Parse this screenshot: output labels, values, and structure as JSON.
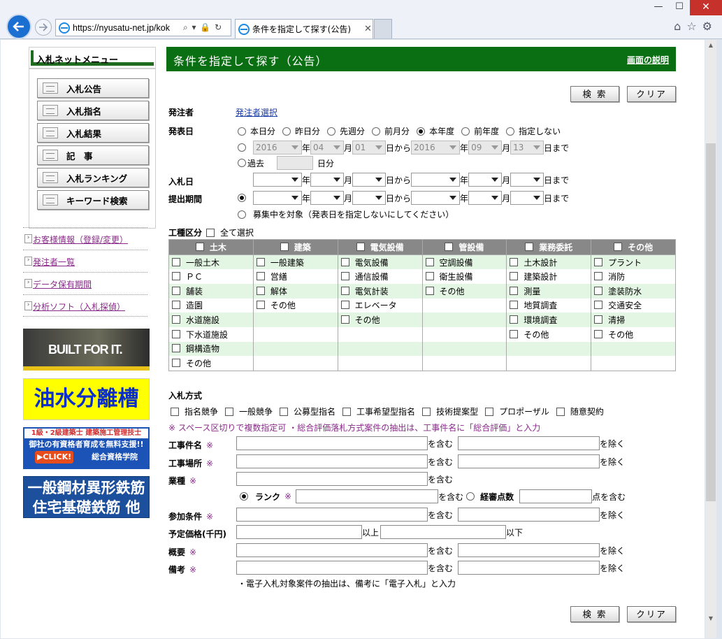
{
  "browser": {
    "url": "https://nyusatu-net.jp/kok",
    "tab_title": "条件を指定して探す(公告)",
    "window_controls": [
      "—",
      "☐",
      "✕"
    ]
  },
  "sidebar": {
    "menu_title": "入札ネットメニュー",
    "menu_items": [
      "入札公告",
      "入札指名",
      "入札結果",
      "記　事",
      "入札ランキング",
      "キーワード検索"
    ],
    "links": [
      "お客様情報（登録/変更）",
      "発注者一覧",
      "データ保有期間",
      "分析ソフト（入札探偵）"
    ],
    "banners": {
      "built": "BUILT FOR IT.",
      "oil": "油水分離槽",
      "school_line1": "1級・2級建築士 建築施工管理技士",
      "school_line2": "御社の有資格者育成を無料支援!!",
      "school_click": "▶CLICK!",
      "school_name": "総合資格学院",
      "steel_line1": "一般鋼材異形鉄筋",
      "steel_line2": "住宅基礎鉄筋 他"
    }
  },
  "main": {
    "title": "条件を指定して探す（公告）",
    "help_link": "画面の説明",
    "search_label": "検 索",
    "clear_label": "クリア",
    "orderer": {
      "label": "発注者",
      "link": "発注者選択"
    },
    "announce": {
      "label": "発表日",
      "options": [
        "本日分",
        "昨日分",
        "先週分",
        "前月分",
        "本年度",
        "前年度",
        "指定しない"
      ],
      "selected": "本年度",
      "range": {
        "from_year": "2016",
        "from_month": "04",
        "from_day": "01",
        "to_year": "2016",
        "to_month": "09",
        "to_day": "13"
      },
      "past_label": "過去",
      "past_unit": "日分"
    },
    "units": {
      "year": "年",
      "month": "月",
      "from": "日から",
      "to": "日まで"
    },
    "bid_date": {
      "label": "入札日"
    },
    "submit_period": {
      "label": "提出期間",
      "recruiting": "募集中を対象（発表日を指定しないにしてください）"
    },
    "kind": {
      "label": "工種区分",
      "select_all": "全て選択",
      "columns": [
        {
          "name": "土木",
          "items": [
            "一般土木",
            "ＰＣ",
            "舗装",
            "造園",
            "水道施設",
            "下水道施設",
            "鋼構造物",
            "その他"
          ]
        },
        {
          "name": "建築",
          "items": [
            "一般建築",
            "営繕",
            "解体",
            "その他"
          ]
        },
        {
          "name": "電気設備",
          "items": [
            "電気設備",
            "通信設備",
            "電気計装",
            "エレベータ",
            "その他"
          ]
        },
        {
          "name": "管設備",
          "items": [
            "空調設備",
            "衛生設備",
            "その他"
          ]
        },
        {
          "name": "業務委託",
          "items": [
            "土木設計",
            "建築設計",
            "測量",
            "地質調査",
            "環境調査",
            "その他"
          ]
        },
        {
          "name": "その他",
          "items": [
            "プラント",
            "消防",
            "塗装防水",
            "交通安全",
            "清掃",
            "その他"
          ]
        }
      ]
    },
    "method": {
      "label": "入札方式",
      "options": [
        "指名競争",
        "一般競争",
        "公募型指名",
        "工事希望型指名",
        "技術提案型",
        "プロポーザル",
        "随意契約"
      ]
    },
    "notice": "※ スペース区切りで複数指定可 ・総合評価落札方式案件の抽出は、工事件名に「総合評価」と入力",
    "mark": "※",
    "fields": {
      "work_name": "工事件名",
      "work_place": "工事場所",
      "industry": "業種",
      "rank": "ランク",
      "score": "経審点数",
      "condition": "参加条件",
      "price": "予定価格(千円)",
      "summary": "概要",
      "remarks": "備考"
    },
    "suffix": {
      "include": "を含む",
      "exclude": "を除く",
      "score_include": "点を含む",
      "above": "以上",
      "below": "以下"
    },
    "footer_note": "・電子入札対象案件の抽出は、備考に「電子入札」と入力"
  }
}
